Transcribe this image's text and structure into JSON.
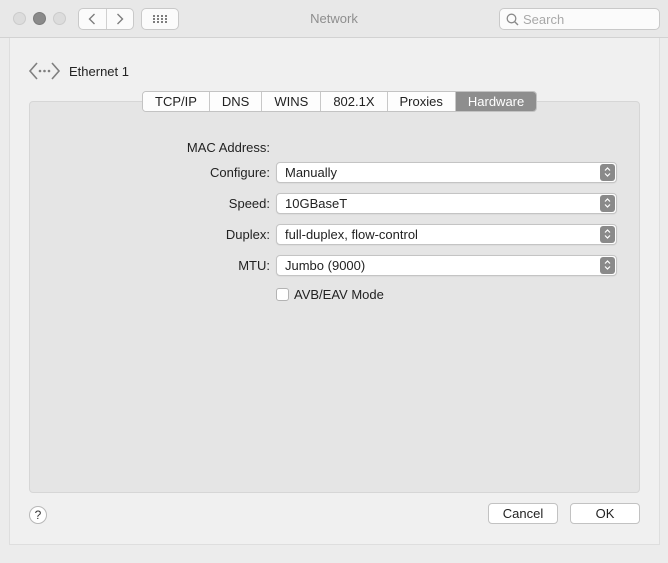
{
  "window": {
    "title": "Network",
    "search_placeholder": "Search"
  },
  "interface": {
    "name": "Ethernet 1",
    "icon": "ethernet-icon"
  },
  "tabs": [
    {
      "label": "TCP/IP",
      "active": false
    },
    {
      "label": "DNS",
      "active": false
    },
    {
      "label": "WINS",
      "active": false
    },
    {
      "label": "802.1X",
      "active": false
    },
    {
      "label": "Proxies",
      "active": false
    },
    {
      "label": "Hardware",
      "active": true
    }
  ],
  "hardware": {
    "mac_label": "MAC Address:",
    "mac_value": "",
    "configure_label": "Configure:",
    "configure_value": "Manually",
    "speed_label": "Speed:",
    "speed_value": "10GBaseT",
    "duplex_label": "Duplex:",
    "duplex_value": "full-duplex, flow-control",
    "mtu_label": "MTU:",
    "mtu_value": "Jumbo (9000)",
    "avb_label": "AVB/EAV Mode",
    "avb_checked": false
  },
  "footer": {
    "help_label": "?",
    "cancel_label": "Cancel",
    "ok_label": "OK"
  },
  "colors": {
    "active_tab": "#8e8e8e",
    "stepper": "#8a8a8a"
  }
}
